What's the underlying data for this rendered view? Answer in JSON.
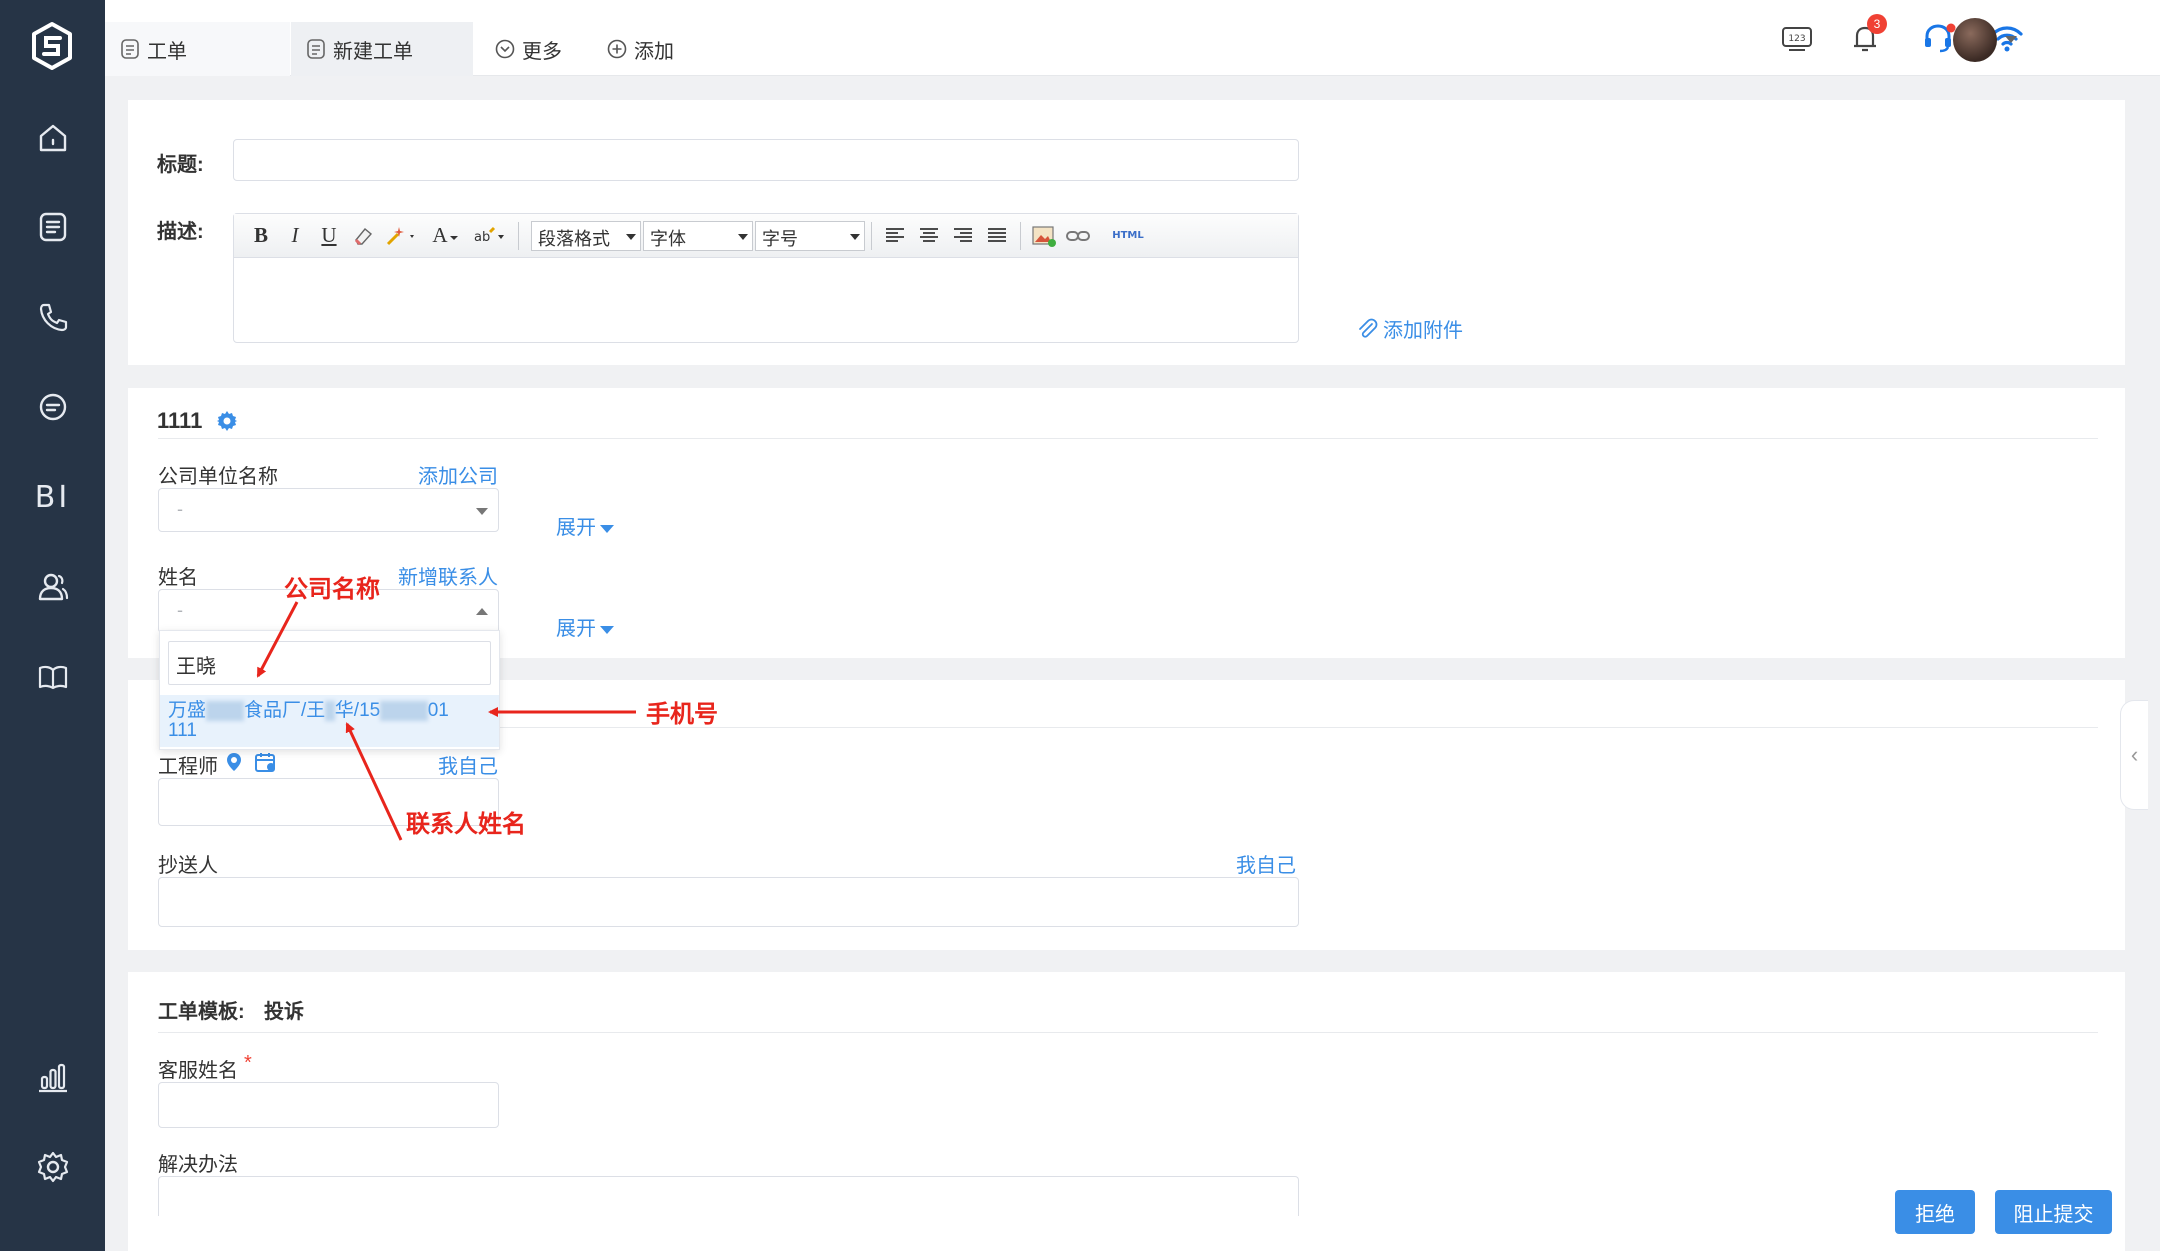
{
  "tabs": [
    {
      "label": "工单"
    },
    {
      "label": "新建工单"
    },
    {
      "label": "更多"
    },
    {
      "label": "添加"
    }
  ],
  "topbar": {
    "notification_count": "3",
    "keyboard_label": "123"
  },
  "sidebar": {
    "bi_label": "BI"
  },
  "form": {
    "title_label": "标题:",
    "desc_label": "描述:",
    "toolbar": {
      "bold": "B",
      "italic": "I",
      "underline": "U",
      "font_color": "A",
      "paragraph": "段落格式",
      "font": "字体",
      "size": "字号",
      "html": "HTML"
    },
    "attach_label": "添加附件"
  },
  "contact_section": {
    "title": "1111",
    "company_label": "公司单位名称",
    "add_company": "添加公司",
    "company_placeholder": "-",
    "expand": "展开",
    "name_label": "姓名",
    "add_contact": "新增联系人",
    "name_placeholder": "-",
    "search_value": "王晓",
    "option_prefix": "万盛",
    "option_mid": "食品厂/王",
    "option_mid2": "华/15",
    "option_end": "01",
    "option_line2": "111"
  },
  "assign_section": {
    "engineer_label": "工程师",
    "myself": "我自己",
    "cc_label": "抄送人",
    "cc_myself": "我自己"
  },
  "template_section": {
    "template_label": "工单模板:",
    "template_value": "投诉",
    "agent_name_label": "客服姓名",
    "required_mark": "*",
    "solution_label": "解决办法"
  },
  "buttons": {
    "reject": "拒绝",
    "block_submit": "阻止提交"
  },
  "annotations": {
    "company": "公司名称",
    "phone": "手机号",
    "contact": "联系人姓名"
  },
  "colors": {
    "sidebar": "#263446",
    "accent": "#3a8ee6",
    "annotation": "#e8251c"
  }
}
